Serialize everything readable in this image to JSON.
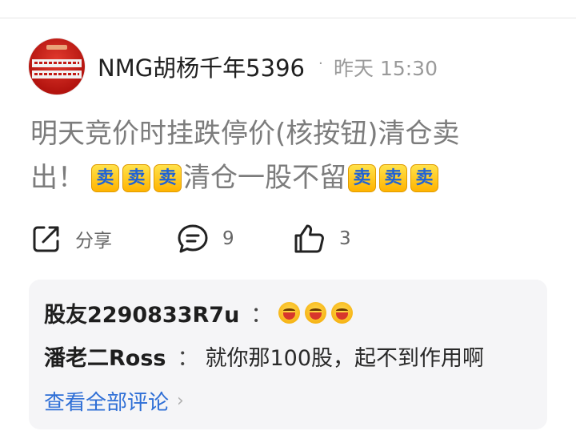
{
  "post": {
    "author": "NMG胡杨千年5396",
    "separator": "·",
    "time": "昨天 15:30",
    "text_line1": "明天竞价时挂跌停价(核按钮)清仓卖",
    "text_line2_start": "出！",
    "text_line2_mid": "清仓一股不留",
    "sell_emoji_glyph": "卖"
  },
  "actions": {
    "share_label": "分享",
    "comment_count": "9",
    "like_count": "3"
  },
  "comments": [
    {
      "name": "股友2290833R7u",
      "colon": "：",
      "text": ""
    },
    {
      "name": "潘老二Ross",
      "colon": "：",
      "text": "就你那100股，起不到作用啊"
    }
  ],
  "view_all_label": "查看全部评论",
  "icons": {
    "share": "share-icon",
    "comment": "comment-icon",
    "like": "thumbs-up-icon",
    "laugh": "laughing-emoji-icon",
    "sell": "sell-sticker-icon",
    "chevron": "chevron-right-icon"
  },
  "colors": {
    "link": "#2f6fd6",
    "post_text": "#7c7c7c",
    "comment_bg": "#f5f5f7"
  }
}
